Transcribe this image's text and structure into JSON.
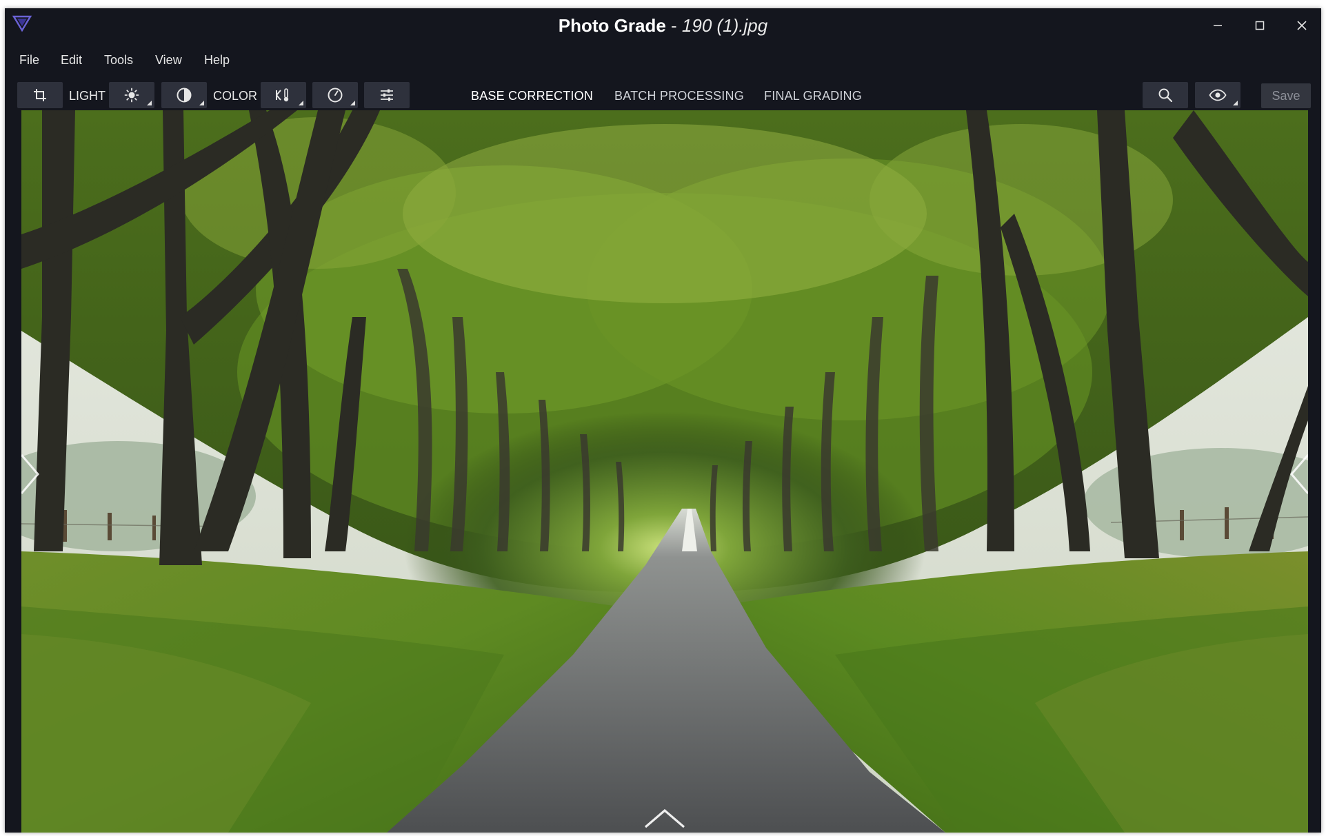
{
  "window": {
    "app_name": "Photo Grade",
    "separator": " - ",
    "file_name": "190 (1).jpg"
  },
  "menu": [
    "File",
    "Edit",
    "Tools",
    "View",
    "Help"
  ],
  "toolbar": {
    "light_label": "LIGHT",
    "color_label": "COLOR",
    "tabs": [
      {
        "label": "BASE CORRECTION",
        "active": true
      },
      {
        "label": "BATCH PROCESSING",
        "active": false
      },
      {
        "label": "FINAL GRADING",
        "active": false
      }
    ],
    "save_label": "Save"
  },
  "icons": {
    "logo": "photo-grade-logo",
    "crop": "crop-icon",
    "brightness": "sun-icon",
    "contrast": "contrast-icon",
    "temperature": "temperature-icon",
    "speed": "clock-icon",
    "adjust": "sliders-icon",
    "zoom": "search-icon",
    "preview": "eye-icon",
    "prev": "chevron-left-icon",
    "next": "chevron-right-icon",
    "panel": "chevron-up-icon"
  },
  "colors": {
    "window_bg": "#14161e",
    "button_bg": "#2e313c",
    "accent": "#5a4fd8",
    "text": "#e6e6e6"
  }
}
